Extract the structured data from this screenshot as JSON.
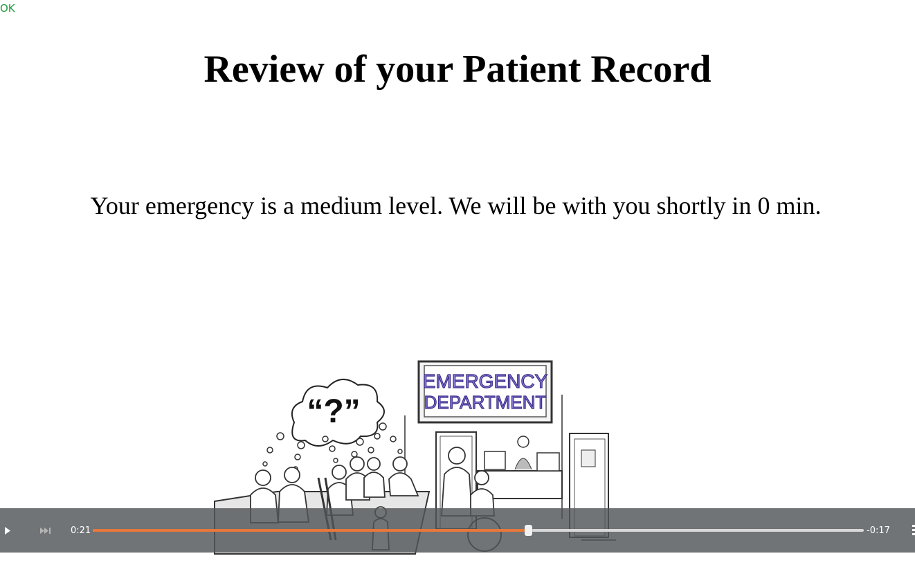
{
  "ok_link": "OK",
  "heading": "Review of your Patient Record",
  "message": "Your emergency is a medium level. We will be with you shortly in 0 min.",
  "video": {
    "sign_line1": "EMERGENCY",
    "sign_line2": "DEPARTMENT",
    "thought_text": "“?”",
    "controls": {
      "play_icon": "play-icon",
      "skip_icon": "skip-forward-icon",
      "elapsed": "0:21",
      "remaining": "-0:17",
      "progress_fraction": 0.565,
      "accent_color": "#e8773c"
    }
  }
}
